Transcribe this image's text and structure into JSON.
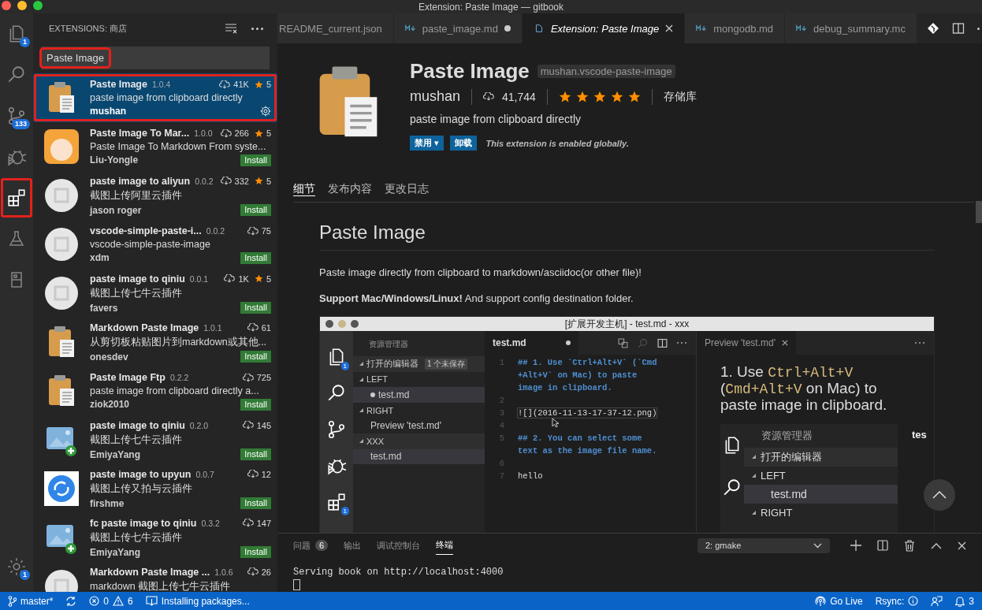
{
  "window": {
    "title": "Extension: Paste Image — gitbook"
  },
  "activity_bar": {
    "items": [
      {
        "kind": "files",
        "badge": "1",
        "selected": false,
        "highlighted": false
      },
      {
        "kind": "search",
        "selected": false,
        "highlighted": false
      },
      {
        "kind": "source-control",
        "badge": "133",
        "selected": false,
        "highlighted": false
      },
      {
        "kind": "debug",
        "selected": false,
        "highlighted": false
      },
      {
        "kind": "extensions",
        "selected": true,
        "highlighted": true
      },
      {
        "kind": "flask",
        "selected": false,
        "highlighted": false
      },
      {
        "kind": "book",
        "selected": false,
        "highlighted": false
      }
    ],
    "settings_badge": "1"
  },
  "sidebar": {
    "title": "EXTENSIONS: 商店",
    "search": {
      "value": "Paste Image",
      "highlighted": true
    },
    "extensions": [
      {
        "kind": "clipboard",
        "name": "Paste Image",
        "version": "1.0.4",
        "downloads": "41K",
        "rating": "5",
        "description": "paste image from clipboard directly",
        "author": "mushan",
        "installed": true,
        "selected": true,
        "highlighted": true
      },
      {
        "kind": "avatar",
        "name": "Paste Image To Mar...",
        "version": "1.0.0",
        "downloads": "266",
        "rating": "5",
        "description": "Paste Image To Markdown From syste...",
        "author": "Liu-Yongle",
        "installed": false,
        "action": "Install",
        "selected": false,
        "highlighted": false
      },
      {
        "kind": "placeholder",
        "name": "paste image to aliyun",
        "version": "0.0.2",
        "downloads": "332",
        "rating": "5",
        "description": "截图上传阿里云插件",
        "author": "jason roger",
        "installed": false,
        "action": "Install",
        "selected": false,
        "highlighted": false
      },
      {
        "kind": "placeholder",
        "name": "vscode-simple-paste-i...",
        "version": "0.0.2",
        "downloads": "75",
        "description": "vscode-simple-paste-image",
        "author": "xdm",
        "installed": false,
        "action": "Install",
        "selected": false,
        "highlighted": false
      },
      {
        "kind": "placeholder",
        "name": "paste image to qiniu",
        "version": "0.0.1",
        "downloads": "1K",
        "rating": "5",
        "description": "截图上传七牛云插件",
        "author": "favers",
        "installed": false,
        "action": "Install",
        "selected": false,
        "highlighted": false
      },
      {
        "kind": "clipboard",
        "name": "Markdown Paste Image",
        "version": "1.0.1",
        "downloads": "61",
        "description": "从剪切板粘贴图片到markdown或其他...",
        "author": "onesdev",
        "installed": false,
        "action": "Install",
        "selected": false,
        "highlighted": false
      },
      {
        "kind": "clipboard",
        "name": "Paste Image Ftp",
        "version": "0.2.2",
        "downloads": "725",
        "description": "paste image from clipboard directly a...",
        "author": "ziok2010",
        "installed": false,
        "action": "Install",
        "selected": false,
        "highlighted": false
      },
      {
        "kind": "picture-plus",
        "name": "paste image to qiniu",
        "version": "0.2.0",
        "downloads": "145",
        "description": "截图上传七牛云插件",
        "author": "EmiyaYang",
        "installed": false,
        "action": "Install",
        "selected": false,
        "highlighted": false
      },
      {
        "kind": "sync",
        "name": "paste image to upyun",
        "version": "0.0.7",
        "downloads": "12",
        "description": "截图上传又拍与云插件",
        "author": "firshme",
        "installed": false,
        "action": "Install",
        "selected": false,
        "highlighted": false
      },
      {
        "kind": "picture-plus",
        "name": "fc paste image to qiniu",
        "version": "0.3.2",
        "downloads": "147",
        "description": "截图上传七牛云插件",
        "author": "EmiyaYang",
        "installed": false,
        "action": "Install",
        "selected": false,
        "highlighted": false
      },
      {
        "kind": "placeholder",
        "name": "Markdown Paste Image ...",
        "version": "1.0.6",
        "downloads": "26",
        "description": "markdown 截图上传七牛云插件",
        "selected": false,
        "highlighted": false
      }
    ]
  },
  "tabs": [
    {
      "label": "README_current.json",
      "kind": "none",
      "dirty": false,
      "preview": false,
      "selected": false
    },
    {
      "label": "paste_image.md",
      "kind": "markdown",
      "dirty": true,
      "preview": false,
      "selected": false
    },
    {
      "label": "Extension: Paste Image",
      "kind": "file",
      "dirty": false,
      "preview": true,
      "selected": true
    },
    {
      "label": "mongodb.md",
      "kind": "markdown",
      "dirty": false,
      "preview": false,
      "selected": false
    },
    {
      "label": "debug_summary.mc",
      "kind": "markdown",
      "dirty": false,
      "preview": false,
      "selected": false
    }
  ],
  "extension": {
    "name": "Paste Image",
    "identifier": "mushan.vscode-paste-image",
    "publisher": "mushan",
    "downloads": "41,744",
    "stars": 5,
    "repository": "存储库",
    "description": "paste image from clipboard directly",
    "buttons": [
      "禁用 ▾",
      "卸载"
    ],
    "status": "This extension is enabled globally.",
    "detail_tabs": [
      {
        "label": "细节",
        "selected": true
      },
      {
        "label": "发布内容",
        "selected": false
      },
      {
        "label": "更改日志",
        "selected": false
      }
    ]
  },
  "readme": {
    "heading": "Paste Image",
    "paragraphs": [
      "Paste image directly from clipboard to markdown/asciidoc(or other file)!",
      "**Support Mac/Windows/Linux!** And support config destination folder."
    ],
    "screenshot": {
      "title": "[扩展开发主机] - test.md - xxx",
      "activity": [
        {
          "kind": "files",
          "badge": "1"
        },
        {
          "kind": "search"
        },
        {
          "kind": "git"
        },
        {
          "kind": "debug"
        },
        {
          "kind": "extensions",
          "badge": "1"
        }
      ],
      "explorer": {
        "title": "资源管理器",
        "sections": [
          {
            "label": "打开的编辑器",
            "badge": "1 个未保存"
          },
          {
            "label": "LEFT",
            "files": [
              {
                "label": "test.md",
                "dirty": true,
                "selected": true
              }
            ]
          },
          {
            "label": "RIGHT",
            "files": [
              {
                "label": "Preview 'test.md'",
                "dirty": false,
                "selected": false
              }
            ]
          },
          {
            "label": "XXX",
            "files": [
              {
                "label": "test.md",
                "dirty": false,
                "selected": true
              }
            ]
          }
        ]
      },
      "editor": {
        "tab": "test.md",
        "dirty": true,
        "lines": [
          {
            "number": "1",
            "kind": "heading",
            "text": "## 1. Use `Ctrl+Alt+V` (`Cmd"
          },
          {
            "kind": "heading",
            "text": "+Alt+V` on Mac) to paste"
          },
          {
            "kind": "heading",
            "text": "image in clipboard."
          },
          {
            "number": "2"
          },
          {
            "number": "3",
            "kind": "boxed",
            "text": "![](2016-11-13-17-37-12.png)"
          },
          {
            "number": "4"
          },
          {
            "number": "5",
            "kind": "heading",
            "text": "## 2. You can select some"
          },
          {
            "kind": "heading",
            "text": "text as the image file name."
          },
          {
            "number": "6"
          },
          {
            "number": "7",
            "kind": "plain",
            "text": "hello"
          }
        ]
      },
      "preview": {
        "tab": "Preview 'test.md'",
        "text": [
          {
            "text": "1. Use ",
            "code": false
          },
          {
            "text": "Ctrl+Alt+V",
            "code": true
          },
          {
            "text": " (",
            "code": false
          },
          {
            "text": "Cmd+Alt+V",
            "code": true
          },
          {
            "text": " on Mac) to paste image in clipboard.",
            "code": false
          }
        ],
        "nested": {
          "title": "资源管理器",
          "editor_tab": "tes",
          "rows": [
            {
              "label": "打开的编辑器",
              "kind": "section",
              "selected": false
            },
            {
              "label": "LEFT",
              "kind": "section",
              "selected": false
            },
            {
              "label": "test.md",
              "kind": "file",
              "selected": true
            },
            {
              "label": "RIGHT",
              "kind": "section",
              "selected": false
            }
          ]
        }
      }
    }
  },
  "panel": {
    "tabs": [
      {
        "label": "问题",
        "badge": "6",
        "selected": false
      },
      {
        "label": "输出",
        "selected": false
      },
      {
        "label": "调试控制台",
        "selected": false
      },
      {
        "label": "终端",
        "selected": true
      }
    ],
    "terminal_select": "2: gmake",
    "terminal_lines": [
      "Serving book on http://localhost:4000"
    ]
  },
  "status_bar": {
    "branch": "master*",
    "errors": "0",
    "warnings": "6",
    "task": "Installing packages...",
    "go_live": "Go Live",
    "rsync": "Rsync:",
    "notifications": "3"
  }
}
